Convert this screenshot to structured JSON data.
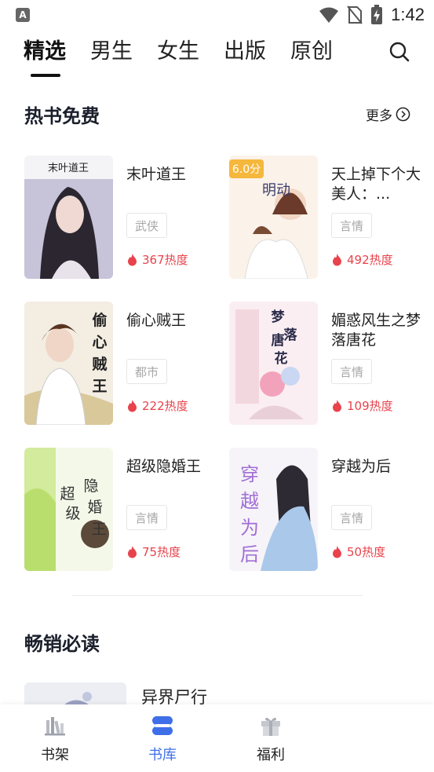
{
  "status_bar": {
    "app_badge": "A",
    "time": "1:42"
  },
  "tabs": [
    {
      "label": "精选",
      "active": true
    },
    {
      "label": "男生"
    },
    {
      "label": "女生"
    },
    {
      "label": "出版"
    },
    {
      "label": "原创"
    }
  ],
  "hot_free": {
    "title": "热书免费",
    "more_label": "更多",
    "books": [
      {
        "title": "末叶道王",
        "genre": "武侠",
        "heat": "367热度",
        "cover_text": "末叶道王"
      },
      {
        "title": "天上掉下个大美人：...",
        "genre": "言情",
        "heat": "492热度",
        "cover_badge": "6.0分"
      },
      {
        "title": "偷心贼王",
        "genre": "都市",
        "heat": "222热度",
        "cover_text": "偷心贼王"
      },
      {
        "title": "媚惑风生之梦落唐花",
        "genre": "言情",
        "heat": "109热度",
        "cover_text": "梦落唐花"
      },
      {
        "title": "超级隐婚王",
        "genre": "言情",
        "heat": "75热度",
        "cover_text": "超级隐婚王"
      },
      {
        "title": "穿越为后",
        "genre": "言情",
        "heat": "50热度",
        "cover_text": "穿越为后"
      }
    ]
  },
  "best_sellers": {
    "title": "畅销必读",
    "books": [
      {
        "title": "异界尸行"
      }
    ]
  },
  "bottom_nav": [
    {
      "label": "书架",
      "icon": "bookshelf-icon"
    },
    {
      "label": "书库",
      "icon": "library-icon",
      "active": true
    },
    {
      "label": "福利",
      "icon": "gift-icon"
    }
  ],
  "colors": {
    "accent": "#3f6fe8",
    "heat": "#e8434c"
  }
}
